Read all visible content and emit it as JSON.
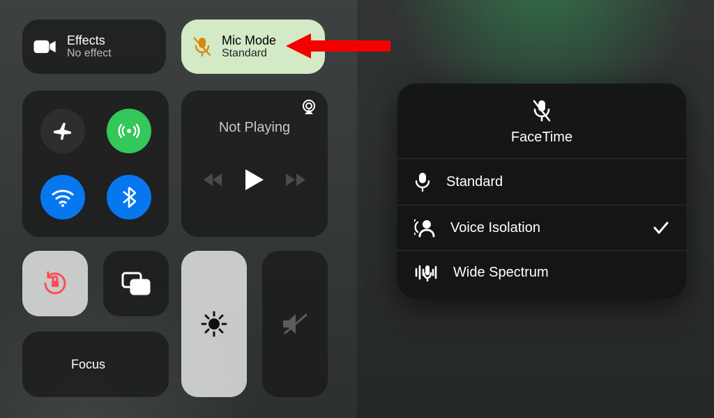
{
  "effects": {
    "title": "Effects",
    "subtitle": "No effect"
  },
  "micmode": {
    "title": "Mic Mode",
    "subtitle": "Standard"
  },
  "media": {
    "status": "Not Playing"
  },
  "focus": {
    "label": "Focus"
  },
  "panel": {
    "app": "FaceTime",
    "options": [
      {
        "label": "Standard",
        "selected": false
      },
      {
        "label": "Voice Isolation",
        "selected": true
      },
      {
        "label": "Wide Spectrum",
        "selected": false
      }
    ]
  }
}
